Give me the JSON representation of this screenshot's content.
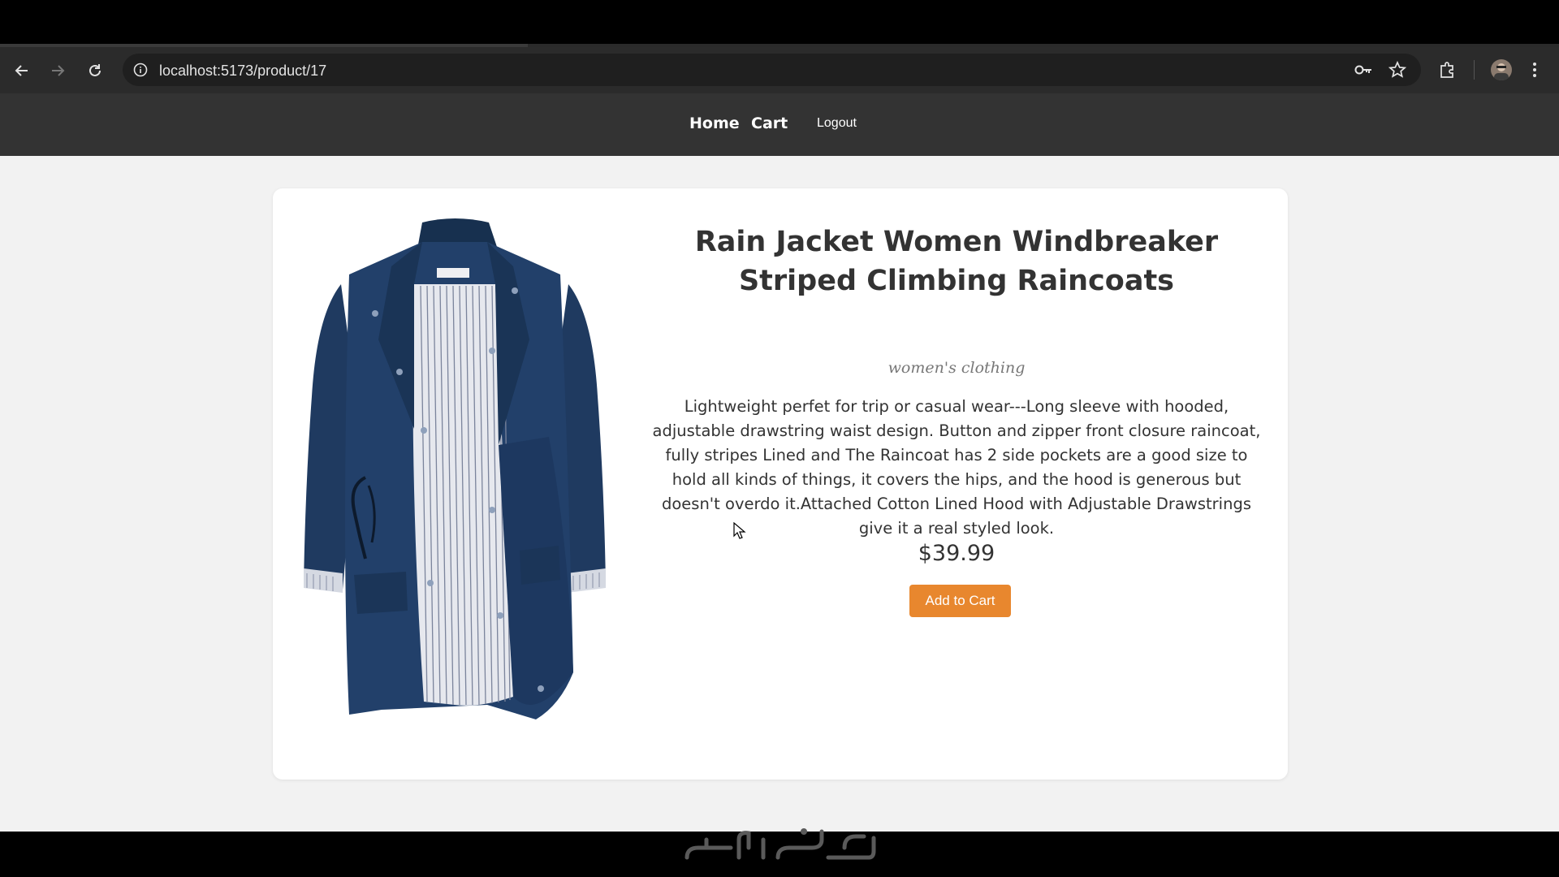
{
  "browser": {
    "url": "localhost:5173/product/17",
    "icons": [
      "back-arrow-icon",
      "forward-arrow-icon",
      "reload-icon",
      "site-info-icon",
      "password-key-icon",
      "bookmark-star-icon",
      "extensions-puzzle-icon",
      "profile-avatar-icon",
      "kebab-menu-icon"
    ]
  },
  "navbar": {
    "home": "Home",
    "cart": "Cart",
    "logout": "Logout"
  },
  "product": {
    "title": "Rain Jacket Women Windbreaker Striped Climbing Raincoats",
    "category": "women's clothing",
    "description": "Lightweight perfet for trip or casual wear---Long sleeve with hooded, adjustable drawstring waist design. Button and zipper front closure raincoat, fully stripes Lined and The Raincoat has 2 side pockets are a good size to hold all kinds of things, it covers the hips, and the hood is generous but doesn't overdo it.Attached Cotton Lined Hood with Adjustable Drawstrings give it a real styled look.",
    "price": "$39.99",
    "add_to_cart": "Add to Cart",
    "image": "navy-rain-jacket-image"
  },
  "watermark": "خمسات",
  "colors": {
    "navbar": "#333333",
    "button": "#e8872e",
    "jacket": "#1f3a60"
  }
}
